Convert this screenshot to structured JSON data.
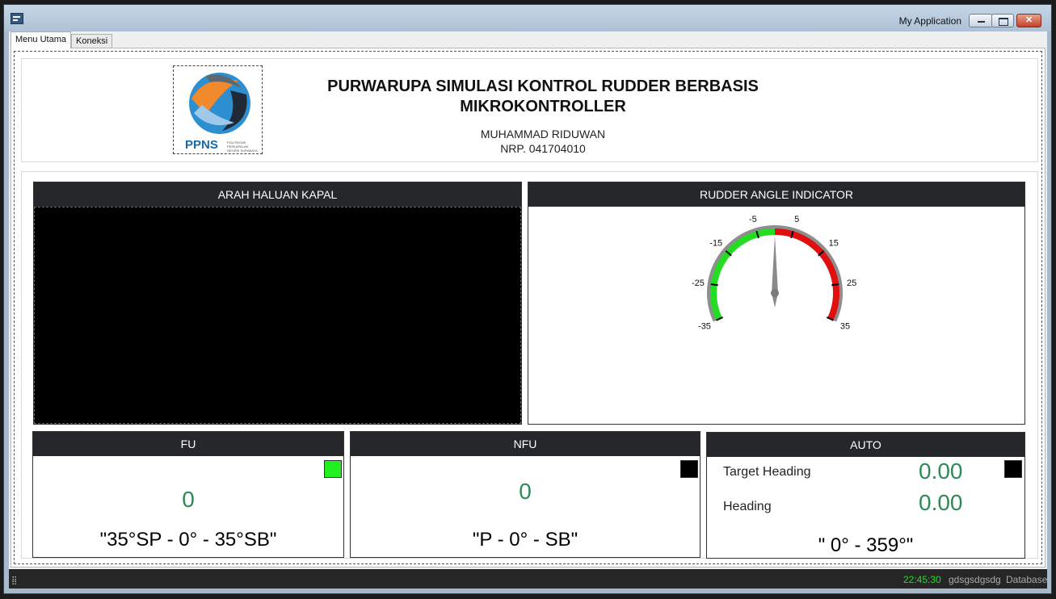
{
  "window": {
    "title": "My Application"
  },
  "tabs": [
    {
      "label": "Menu Utama",
      "active": true
    },
    {
      "label": "Koneksi",
      "active": false
    }
  ],
  "header": {
    "title_line1": "PURWARUPA SIMULASI KONTROL RUDDER BERBASIS",
    "title_line2": "MIKROKONTROLLER",
    "name": "MUHAMMAD RIDUWAN",
    "nrp": "NRP. 041704010",
    "logo_text": "PPNS",
    "logo_subtext": [
      "POLITEKNIK",
      "PERKAPALAN",
      "NEGERI SURABAYA"
    ]
  },
  "arah_haluan": {
    "title": "ARAH HALUAN KAPAL"
  },
  "rudder_indicator": {
    "title": "RUDDER ANGLE INDICATOR",
    "tick_labels": [
      "-35",
      "-25",
      "-15",
      "-5",
      "5",
      "15",
      "25",
      "35"
    ],
    "needle_value": 0,
    "port_color": "#22dd22",
    "starboard_color": "#e01010"
  },
  "fu": {
    "title": "FU",
    "value": "0",
    "range": "\"35°SP - 0° - 35°SB\"",
    "indicator_color": "#22ee22"
  },
  "nfu": {
    "title": "NFU",
    "value": "0",
    "range": "\"P - 0° - SB\"",
    "indicator_color": "#000000"
  },
  "auto": {
    "title": "AUTO",
    "target_heading_label": "Target Heading",
    "target_heading_value": "0.00",
    "heading_label": "Heading",
    "heading_value": "0.00",
    "range": "\" 0° - 359°\"",
    "indicator_color": "#000000"
  },
  "status": {
    "time": "22:45:30",
    "text1": "gdsgsdgsdg",
    "text2": "Database"
  }
}
